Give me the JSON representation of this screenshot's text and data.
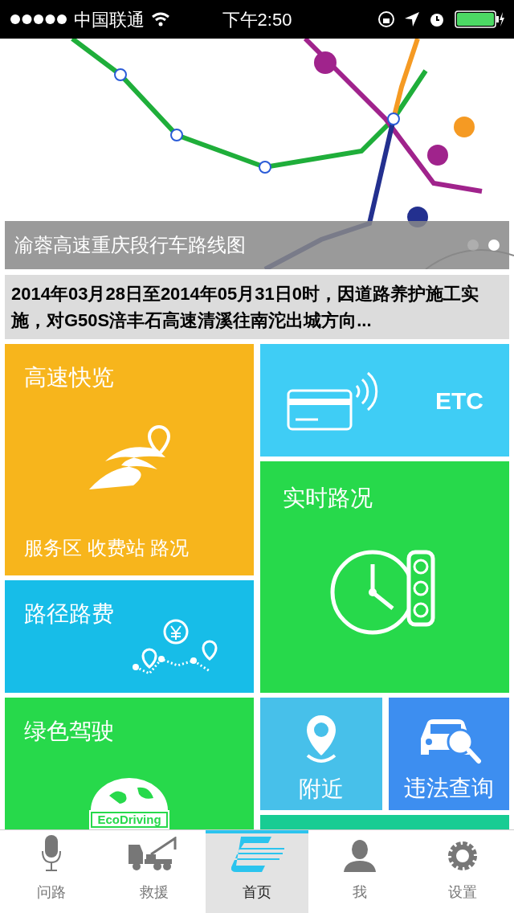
{
  "status_bar": {
    "carrier": "中国联通",
    "time": "下午2:50"
  },
  "banner": {
    "caption": "渝蓉高速重庆段行车路线图",
    "pager": [
      {
        "selected": false
      },
      {
        "selected": true
      }
    ]
  },
  "notice": "2014年03月28日至2014年05月31日0时，因道路养护施工实施，对G50S涪丰石高速清溪往南沱出城方向...",
  "tiles": [
    {
      "kind": "highway",
      "title": "高速快览",
      "subtitle": "服务区 收费站 路况",
      "color": "#f7b51c"
    },
    {
      "kind": "route",
      "title": "路径路费",
      "color": "#17bde8"
    },
    {
      "kind": "eco",
      "title": "绿色驾驶",
      "badge": "EcoDriving",
      "color": "#27d94b"
    },
    {
      "kind": "etc",
      "title": "ETC",
      "color": "#3fcdf5"
    },
    {
      "kind": "traffic",
      "title": "实时路况",
      "color": "#27d94b"
    },
    {
      "kind": "nearby",
      "title": "附近",
      "color": "#47c0ea"
    },
    {
      "kind": "violation",
      "title": "违法查询",
      "color": "#3d8ef0"
    },
    {
      "kind": "more",
      "color": "#18cc93"
    }
  ],
  "tab_bar": [
    {
      "kind": "mic",
      "label": "问路",
      "selected": false
    },
    {
      "kind": "truck",
      "label": "救援",
      "selected": false
    },
    {
      "kind": "home",
      "label": "首页",
      "selected": true
    },
    {
      "kind": "user",
      "label": "我",
      "selected": false
    },
    {
      "kind": "gear",
      "label": "设置",
      "selected": false
    }
  ]
}
